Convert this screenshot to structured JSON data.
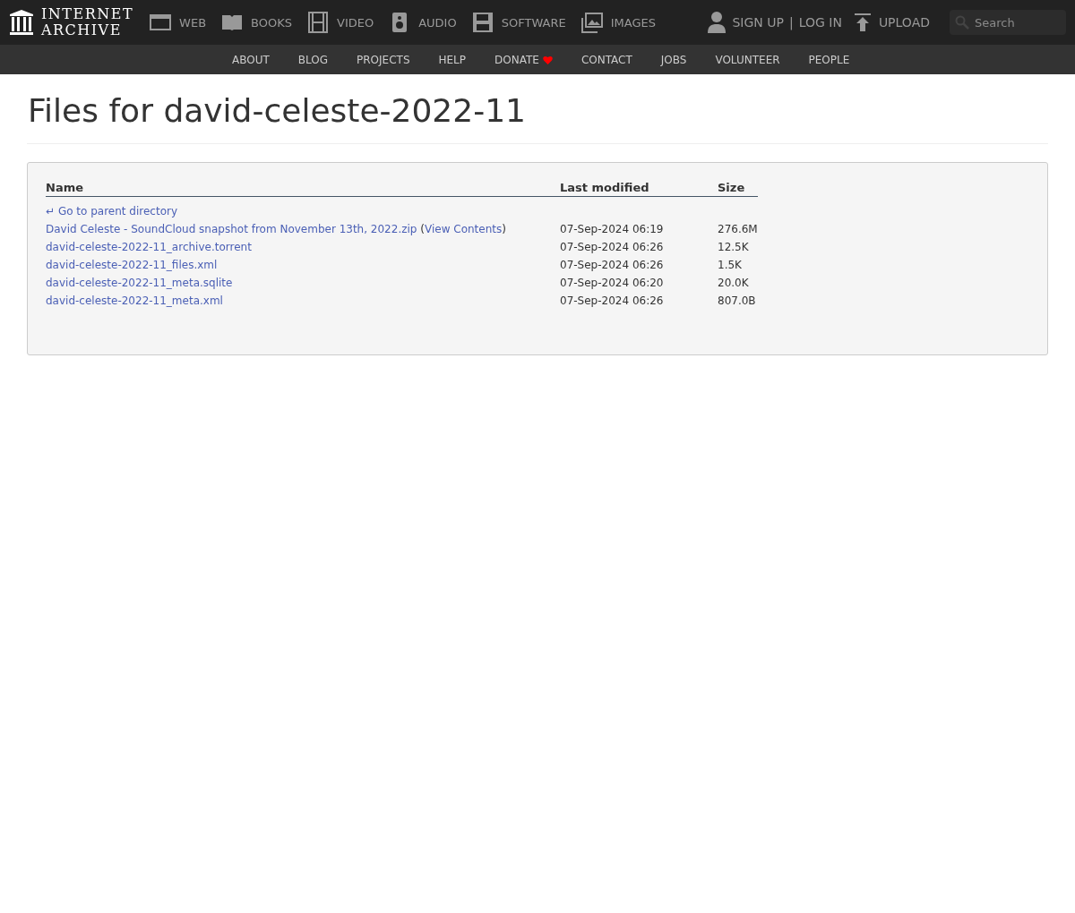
{
  "logo": {
    "line_1": "INTERNET",
    "line_2": "ARCHIVE"
  },
  "media_nav": [
    {
      "kind": "web",
      "label": "WEB"
    },
    {
      "kind": "books",
      "label": "BOOKS"
    },
    {
      "kind": "video",
      "label": "VIDEO"
    },
    {
      "kind": "audio",
      "label": "AUDIO"
    },
    {
      "kind": "software",
      "label": "SOFTWARE"
    },
    {
      "kind": "images",
      "label": "IMAGES"
    }
  ],
  "account": {
    "sign_up": "SIGN UP",
    "separator": "|",
    "log_in": "LOG IN"
  },
  "upload": "UPLOAD",
  "search": {
    "placeholder": "Search"
  },
  "sub_nav": [
    {
      "label": "ABOUT",
      "heart": false
    },
    {
      "label": "BLOG",
      "heart": false
    },
    {
      "label": "PROJECTS",
      "heart": false
    },
    {
      "label": "HELP",
      "heart": false
    },
    {
      "label": "DONATE",
      "heart": true
    },
    {
      "label": "CONTACT",
      "heart": false
    },
    {
      "label": "JOBS",
      "heart": false
    },
    {
      "label": "VOLUNTEER",
      "heart": false
    },
    {
      "label": "PEOPLE",
      "heart": false
    }
  ],
  "title": "Files for david-celeste-2022-11",
  "table": {
    "columns": [
      "Name",
      "Last modified",
      "Size"
    ],
    "parent_link": {
      "arrow": "↵",
      "label": "Go to parent directory"
    },
    "rows": [
      {
        "name": "David Celeste - SoundCloud snapshot from November 13th, 2022.zip",
        "view_contents": {
          "open": "(",
          "label": "View Contents",
          "close": ")"
        },
        "modified": "07-Sep-2024 06:19",
        "size": "276.6M"
      },
      {
        "name": "david-celeste-2022-11_archive.torrent",
        "modified": "07-Sep-2024 06:26",
        "size": "12.5K"
      },
      {
        "name": "david-celeste-2022-11_files.xml",
        "modified": "07-Sep-2024 06:26",
        "size": "1.5K"
      },
      {
        "name": "david-celeste-2022-11_meta.sqlite",
        "modified": "07-Sep-2024 06:20",
        "size": "20.0K"
      },
      {
        "name": "david-celeste-2022-11_meta.xml",
        "modified": "07-Sep-2024 06:26",
        "size": "807.0B"
      }
    ]
  }
}
